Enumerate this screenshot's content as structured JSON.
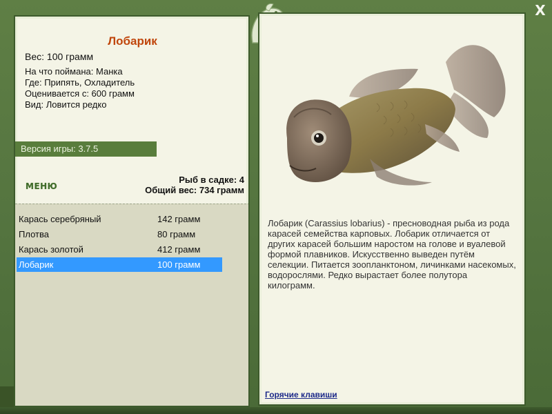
{
  "dialog": {
    "close_label": "X",
    "logo_icon": "fish-emblem-icon"
  },
  "left": {
    "fish_name": "Лобарик",
    "weight_line": "Вес: 100 грамм",
    "info": [
      "На что поймана: Манка",
      "Где: Припять, Охладитель",
      "Оценивается с: 600 грамм",
      "Вид: Ловится редко"
    ],
    "version": "Версия игры: 3.7.5",
    "menu_label": "МЕНЮ",
    "fish_count": "Рыб в садке: 4",
    "total_weight": "Общий вес: 734 грамм"
  },
  "catch_list": [
    {
      "name": "Карась серебряный",
      "weight": "142 грамм",
      "selected": false
    },
    {
      "name": "Плотва",
      "weight": "80 грамм",
      "selected": false
    },
    {
      "name": "Карась золотой",
      "weight": "412 грамм",
      "selected": false
    },
    {
      "name": "Лобарик",
      "weight": "100 грамм",
      "selected": true
    }
  ],
  "right": {
    "fish_image_icon": "lobarik-fish-image",
    "description": "Лобарик (Carassius lobarius) - пресноводная рыба из рода карасей семейства карповых. Лобарик отличается от других карасей большим наростом на голове и вуалевой формой плавников. Искусственно выведен путём селекции. Питается зоопланктоном, личинками насекомых, водорослями. Редко вырастает более полутора килограмм.",
    "hotkeys_label": "Горячие клавиши"
  },
  "colors": {
    "frame_green": "#557540",
    "panel_bg": "#f4f4e6",
    "title_orange": "#c0460c",
    "selection_blue": "#3399ff",
    "link_blue": "#1d2a8a"
  }
}
